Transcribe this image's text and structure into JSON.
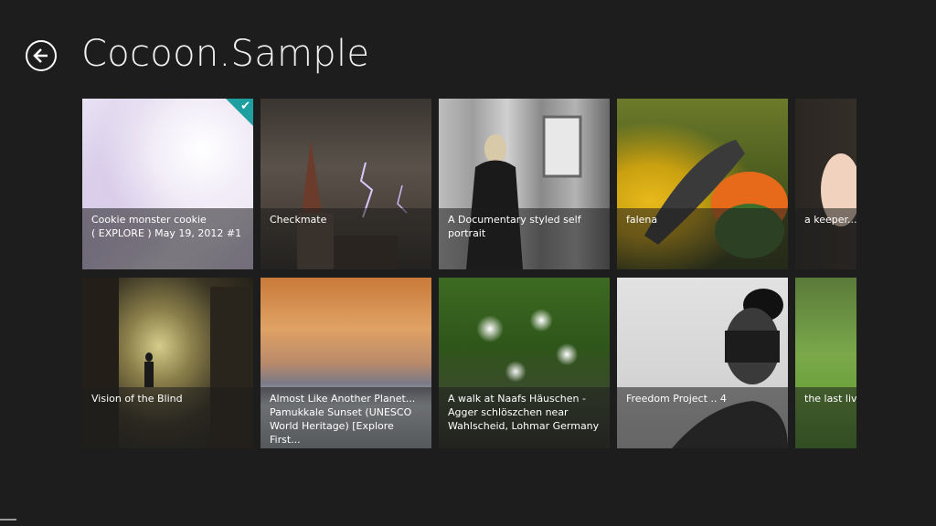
{
  "header": {
    "title": "Cocoon.Sample",
    "back_icon": "back-arrow-icon"
  },
  "selection": {
    "accent_color": "#1f9f9f",
    "check_icon": "checkmark-icon",
    "check_glyph": "✔"
  },
  "tiles": [
    {
      "caption": "Cookie monster cookie\n( EXPLORE ) May 19, 2012 #1",
      "selected": true
    },
    {
      "caption": "Checkmate",
      "selected": false
    },
    {
      "caption": "A Documentary styled self\nportrait",
      "selected": false
    },
    {
      "caption": "falena",
      "selected": false
    },
    {
      "caption": "a keeper....",
      "selected": false
    },
    {
      "caption": "Vision of the Blind",
      "selected": false
    },
    {
      "caption": "Almost Like Another Planet...\nPamukkale Sunset (UNESCO\nWorld Heritage) [Explore First...",
      "selected": false
    },
    {
      "caption": "A walk at Naafs Häuschen  -\nAgger schlöszchen near\nWahlscheid, Lohmar Germany",
      "selected": false
    },
    {
      "caption": "Freedom Project .. 4",
      "selected": false
    },
    {
      "caption": "the last livin",
      "selected": false
    }
  ]
}
